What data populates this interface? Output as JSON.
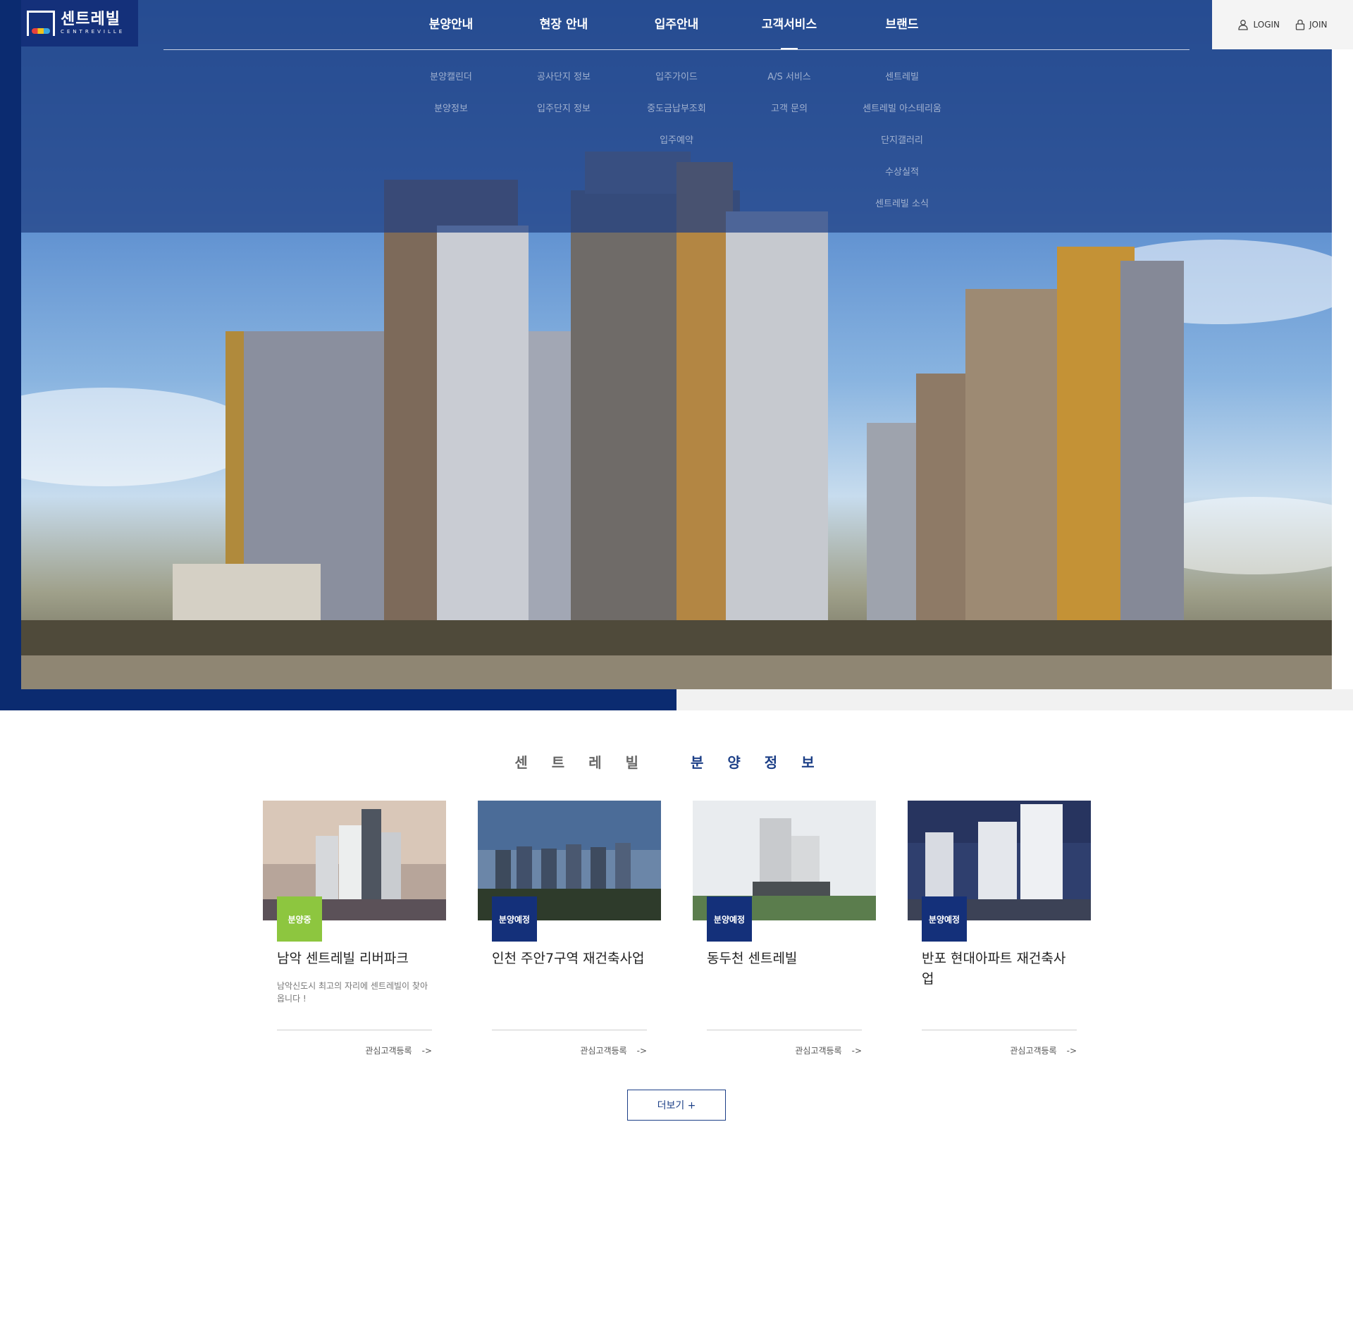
{
  "brand": {
    "name_ko": "센트레빌",
    "name_en": "CENTREVILLE",
    "color_primary": "#0b2b70",
    "color_accent": "#8dc63f"
  },
  "nav": {
    "menus": [
      {
        "label": "분양안내",
        "active": false,
        "sub": [
          "분양캘린더",
          "분양정보"
        ]
      },
      {
        "label": "현장 안내",
        "active": false,
        "sub": [
          "공사단지 정보",
          "입주단지 정보"
        ]
      },
      {
        "label": "입주안내",
        "active": false,
        "sub": [
          "입주가이드",
          "중도금납부조회",
          "입주예약"
        ]
      },
      {
        "label": "고객서비스",
        "active": true,
        "sub": [
          "A/S 서비스",
          "고객 문의"
        ]
      },
      {
        "label": "브랜드",
        "active": false,
        "sub": [
          "센트레빌",
          "센트레빌 아스테리움",
          "단지갤러리",
          "수상실적",
          "센트레빌 소식"
        ]
      }
    ]
  },
  "util": {
    "login": "LOGIN",
    "join": "JOIN",
    "login_icon": "user-icon",
    "join_icon": "lock-icon"
  },
  "section": {
    "title_left": "센트레빌",
    "title_right": "분양정보"
  },
  "cards": [
    {
      "badge": "분양중",
      "badge_color": "#8dc63f",
      "title": "남악 센트레빌 리버파크",
      "desc": "남악신도시 최고의 자리에 센트레빌이 찾아옵니다 !",
      "link": "관심고객등록",
      "arrow": "->"
    },
    {
      "badge": "분양예정",
      "badge_color": "#14307a",
      "title": "인천 주안7구역 재건축사업",
      "desc": "",
      "link": "관심고객등록",
      "arrow": "->"
    },
    {
      "badge": "분양예정",
      "badge_color": "#14307a",
      "title": "동두천 센트레빌",
      "desc": "",
      "link": "관심고객등록",
      "arrow": "->"
    },
    {
      "badge": "분양예정",
      "badge_color": "#14307a",
      "title": "반포 현대아파트 재건축사업",
      "desc": "",
      "link": "관심고객등록",
      "arrow": "->"
    }
  ],
  "more_button": "더보기 +"
}
